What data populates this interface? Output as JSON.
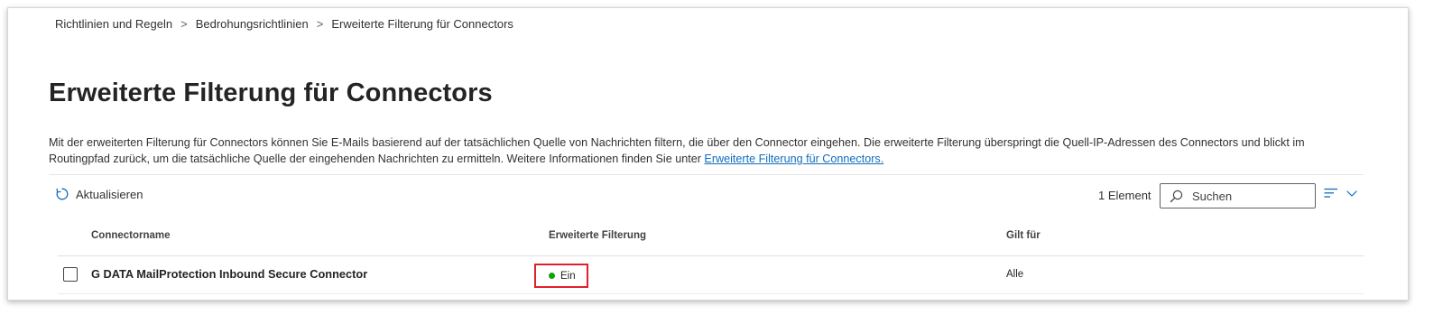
{
  "breadcrumb": {
    "items": [
      "Richtlinien und Regeln",
      "Bedrohungsrichtlinien",
      "Erweiterte Filterung für Connectors"
    ],
    "separator": ">"
  },
  "page": {
    "title": "Erweiterte Filterung für Connectors",
    "description": "Mit der erweiterten Filterung für Connectors können Sie E-Mails basierend auf der tatsächlichen Quelle von Nachrichten filtern, die über den Connector eingehen. Die erweiterte Filterung überspringt die Quell-IP-Adressen des Connectors und blickt im Routingpfad zurück, um die tatsächliche Quelle der eingehenden Nachrichten zu ermitteln. Weitere Informationen finden Sie unter ",
    "link_text": "Erweiterte Filterung für Connectors."
  },
  "toolbar": {
    "refresh_label": "Aktualisieren",
    "item_count": "1 Element",
    "search_placeholder": "Suchen"
  },
  "icons": {
    "refresh": "refresh-icon",
    "search": "search-icon",
    "filter": "filter-lines-icon",
    "chevron": "chevron-down-icon",
    "status_dot": "status-dot-icon"
  },
  "table": {
    "columns": [
      "Connectorname",
      "Erweiterte Filterung",
      "Gilt für"
    ],
    "rows": [
      {
        "name": "G DATA MailProtection Inbound Secure Connector",
        "filtering": "Ein",
        "applies_to": "Alle"
      }
    ]
  },
  "colors": {
    "accent": "#0f6cbd",
    "status_on": "#13a10e",
    "highlight_border": "#e0202a"
  }
}
